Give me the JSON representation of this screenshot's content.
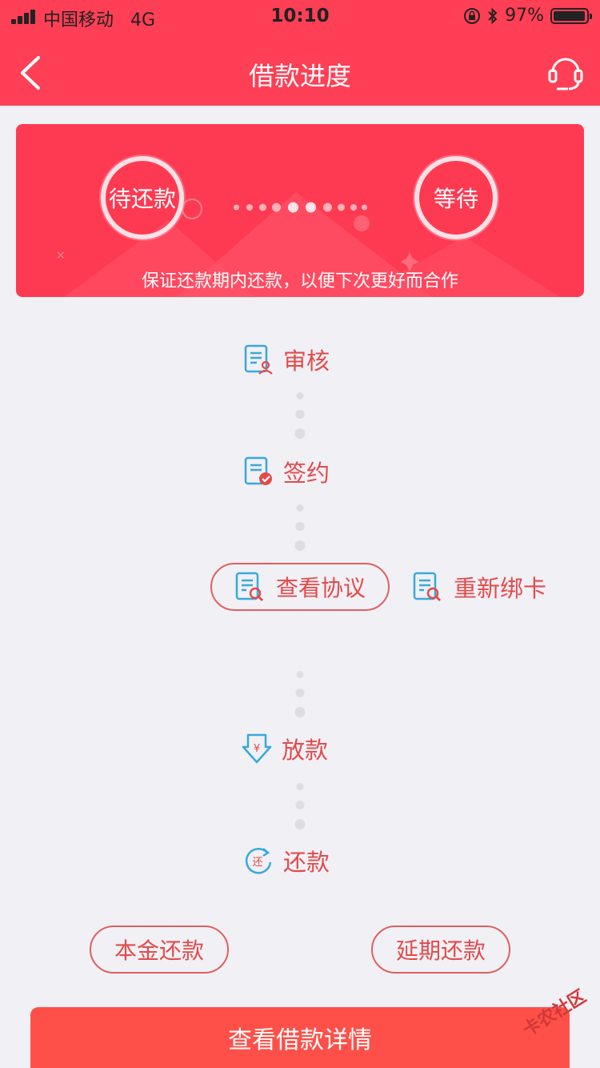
{
  "status_bar": {
    "carrier": "中国移动",
    "network": "4G",
    "time": "10:10",
    "battery": "97%",
    "battery_level": 0.97
  },
  "nav": {
    "title": "借款进度",
    "back_icon": "chevron-left-icon",
    "support_icon": "headset-icon"
  },
  "banner": {
    "current_status": "待还款",
    "next_status": "等待",
    "caption": "保证还款期内还款，以便下次更好而合作"
  },
  "steps": {
    "review": "审核",
    "sign": "签约",
    "disburse": "放款",
    "repay": "还款"
  },
  "actions": {
    "view_agreement": "查看协议",
    "rebind_card": "重新绑卡",
    "principal_repay": "本金还款",
    "extend_repay": "延期还款",
    "view_details": "查看借款详情"
  },
  "watermark": "卡农社区",
  "colors": {
    "brand": "#fe3f55",
    "accent_text": "#e34b4b",
    "icon_blue": "#3aa8d8",
    "bottom_button": "#fe5048"
  }
}
